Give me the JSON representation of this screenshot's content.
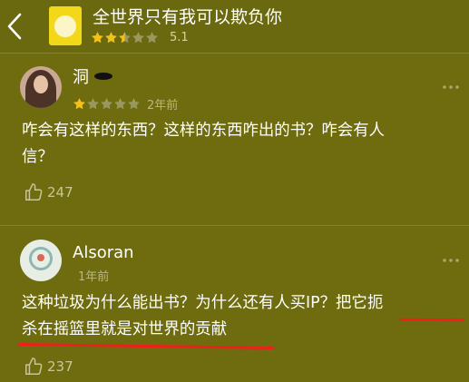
{
  "header": {
    "back_icon": "chevron-left-icon",
    "book_title": "全世界只有我可以欺负你",
    "rating_stars": 2.5,
    "rating_score": "5.1"
  },
  "comments": [
    {
      "username": "洞",
      "avatar": "user-avatar-photo",
      "stars": 1,
      "time": "2年前",
      "lines": [
        "咋会有这样的东西？这样的东西咋出的书？咋会有人",
        "信？"
      ],
      "likes": "247"
    },
    {
      "username": "Alsoran",
      "avatar": "user-avatar-image",
      "stars": 0,
      "time": "1年前",
      "lines": [
        "这种垃圾为什么能出书？为什么还有人买IP？把它扼",
        "杀在摇篮里就是对世界的贡献"
      ],
      "likes": "237"
    }
  ],
  "icons": {
    "more": "more-dots-icon",
    "like": "thumbs-up-icon",
    "star": "star-icon"
  },
  "colors": {
    "background": "#6f6c10",
    "star_filled": "#f3c21a",
    "star_empty": "#9a9860",
    "underline": "#f01f1a"
  }
}
